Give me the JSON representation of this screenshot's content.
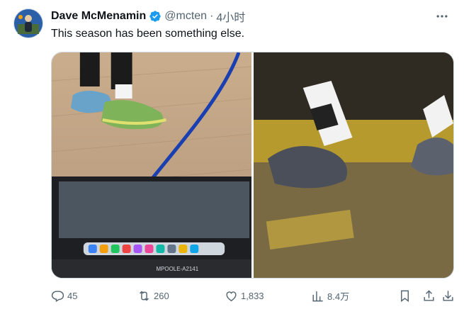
{
  "tweet": {
    "author_name": "Dave McMenamin",
    "handle": "@mcten",
    "separator": "·",
    "time": "4小时",
    "text": "This season has been something else.",
    "media": {
      "left_overlay_text": "MPOOLE-A2141"
    },
    "actions": {
      "replies": "45",
      "retweets": "260",
      "likes": "1,833",
      "views": "8.4万"
    }
  },
  "icons": {
    "verified": "verified-badge-icon",
    "more": "more-horizontal-icon",
    "reply": "reply-icon",
    "retweet": "retweet-icon",
    "like": "heart-icon",
    "views": "bar-chart-icon",
    "bookmark": "bookmark-icon",
    "share": "share-icon",
    "download": "download-icon"
  },
  "colors": {
    "text_primary": "#0f1419",
    "text_secondary": "#536471",
    "verified_blue": "#1d9bf0"
  }
}
